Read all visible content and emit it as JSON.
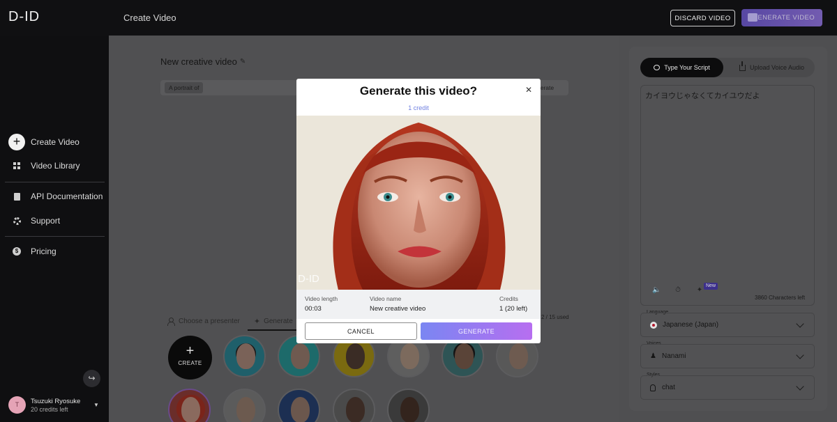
{
  "app": {
    "logo": "D-ID",
    "page_title": "Create Video"
  },
  "header": {
    "discard_label": "DISCARD VIDEO",
    "generate_label": "GENERATE VIDEO"
  },
  "sidebar": {
    "items": [
      {
        "label": "Create Video",
        "icon": "plus-circle-icon"
      },
      {
        "label": "Video Library",
        "icon": "grid-icon"
      },
      {
        "label": "API Documentation",
        "icon": "document-icon"
      },
      {
        "label": "Support",
        "icon": "lifebuoy-icon"
      },
      {
        "label": "Pricing",
        "icon": "dollar-icon"
      }
    ],
    "user": {
      "initial": "T",
      "name": "Tsuzuki Ryosuke",
      "credits": "20 credits left"
    }
  },
  "editor": {
    "video_title": "New creative video",
    "prompt_tag": "A portrait of",
    "prompt_generate": "nerate",
    "tab_choose": "Choose a presenter",
    "tab_generate": "Generate",
    "used_count": "2 / 15 used",
    "create_label": "CREATE"
  },
  "script_panel": {
    "tab_type": "Type Your Script",
    "tab_upload": "Upload Voice Audio",
    "script_text": "カイヨウじゃなくてカイユウだよ",
    "new_badge": "New",
    "chars_left": "3860 Characters left",
    "language_label": "Language",
    "language_value": "Japanese (Japan)",
    "voices_label": "Voices",
    "voices_value": "Nanami",
    "styles_label": "Styles",
    "styles_value": "chat"
  },
  "modal": {
    "title": "Generate this video?",
    "credit": "1 credit",
    "watermark": "D-ID",
    "video_length_label": "Video length",
    "video_length_value": "00:03",
    "video_name_label": "Video name",
    "video_name_value": "New creative video",
    "credits_label": "Credits",
    "credits_value": "1 (20 left)",
    "cancel_label": "CANCEL",
    "generate_label": "GENERATE"
  },
  "colors": {
    "accent_gradient_start": "#7a86f2",
    "accent_gradient_end": "#b76ef0",
    "credit_link": "#6f7fe0"
  }
}
